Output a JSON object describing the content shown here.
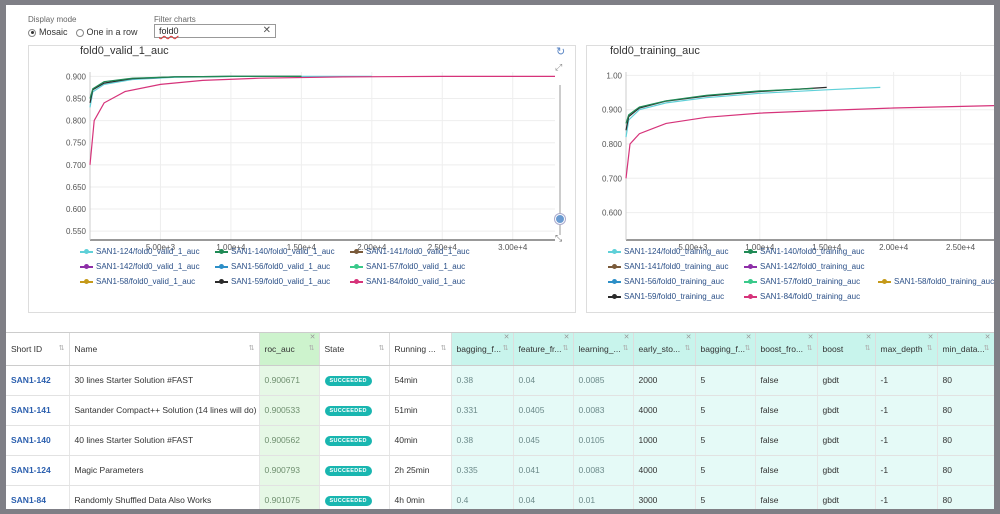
{
  "controls": {
    "display_mode_label": "Display mode",
    "mode_mosaic": "Mosaic",
    "mode_one_in_row": "One in a row",
    "filter_label": "Filter charts",
    "filter_value": "fold0",
    "clear_icon": "✕"
  },
  "charts": [
    {
      "id": "valid",
      "title": "fold0_valid_1_auc",
      "legend": [
        {
          "label": "SAN1-124/fold0_valid_1_auc",
          "color": "#5fd0d8"
        },
        {
          "label": "SAN1-140/fold0_valid_1_auc",
          "color": "#1f8a55"
        },
        {
          "label": "SAN1-141/fold0_valid_1_auc",
          "color": "#7a5a3a"
        },
        {
          "label": "SAN1-142/fold0_valid_1_auc",
          "color": "#8e2fa8"
        },
        {
          "label": "SAN1-56/fold0_valid_1_auc",
          "color": "#2d8fc7"
        },
        {
          "label": "SAN1-57/fold0_valid_1_auc",
          "color": "#3ac98a"
        },
        {
          "label": "SAN1-58/fold0_valid_1_auc",
          "color": "#c59a1a"
        },
        {
          "label": "SAN1-59/fold0_valid_1_auc",
          "color": "#2b2b2b"
        },
        {
          "label": "SAN1-84/fold0_valid_1_auc",
          "color": "#d6337a"
        }
      ]
    },
    {
      "id": "training",
      "title": "fold0_training_auc",
      "legend": [
        {
          "label": "SAN1-124/fold0_training_auc",
          "color": "#5fd0d8"
        },
        {
          "label": "SAN1-140/fold0_training_auc",
          "color": "#1f8a55"
        },
        {
          "label": "SAN1-141/fold0_training_auc",
          "color": "#7a5a3a"
        },
        {
          "label": "SAN1-142/fold0_training_auc",
          "color": "#8e2fa8"
        },
        {
          "label": "SAN1-56/fold0_training_auc",
          "color": "#2d8fc7"
        },
        {
          "label": "SAN1-57/fold0_training_auc",
          "color": "#3ac98a"
        },
        {
          "label": "SAN1-58/fold0_training_auc",
          "color": "#c59a1a"
        },
        {
          "label": "SAN1-59/fold0_training_auc",
          "color": "#2b2b2b"
        },
        {
          "label": "SAN1-84/fold0_training_auc",
          "color": "#d6337a"
        }
      ]
    }
  ],
  "chart_data": [
    {
      "type": "line",
      "title": "fold0_valid_1_auc",
      "xlabel": "",
      "ylabel": "",
      "x_ticks": [
        "5.00e+3",
        "1.00e+4",
        "1.50e+4",
        "2.00e+4",
        "2.50e+4",
        "3.00e+4"
      ],
      "x_tick_values": [
        5000,
        10000,
        15000,
        20000,
        25000,
        30000
      ],
      "y_ticks": [
        "0.900",
        "0.850",
        "0.800",
        "0.750",
        "0.700",
        "0.650",
        "0.600",
        "0.550"
      ],
      "y_tick_values": [
        0.9,
        0.85,
        0.8,
        0.75,
        0.7,
        0.65,
        0.6,
        0.55
      ],
      "xlim": [
        0,
        33000
      ],
      "ylim": [
        0.53,
        0.91
      ],
      "grid": true,
      "series": [
        {
          "name": "SAN1-124/fold0_valid_1_auc",
          "color": "#5fd0d8",
          "x": [
            0,
            200,
            1000,
            3000,
            6000,
            10000,
            15000,
            20000
          ],
          "y": [
            0.83,
            0.865,
            0.882,
            0.893,
            0.898,
            0.9,
            0.9,
            0.9
          ]
        },
        {
          "name": "SAN1-59/fold0_valid_1_auc",
          "color": "#2b2b2b",
          "x": [
            0,
            200,
            1000,
            3000,
            6000,
            10000,
            15000
          ],
          "y": [
            0.84,
            0.87,
            0.885,
            0.895,
            0.899,
            0.9,
            0.9
          ]
        },
        {
          "name": "SAN1-140/fold0_valid_1_auc",
          "color": "#1f8a55",
          "x": [
            0,
            200,
            1000,
            3000,
            6000,
            10000,
            15000
          ],
          "y": [
            0.85,
            0.872,
            0.888,
            0.896,
            0.899,
            0.9,
            0.9
          ]
        },
        {
          "name": "SAN1-84/fold0_valid_1_auc",
          "color": "#d6337a",
          "x": [
            0,
            300,
            1000,
            2500,
            5000,
            8000,
            12000,
            18000,
            25000,
            33000
          ],
          "y": [
            0.7,
            0.8,
            0.84,
            0.866,
            0.882,
            0.891,
            0.896,
            0.899,
            0.9,
            0.9
          ]
        }
      ]
    },
    {
      "type": "line",
      "title": "fold0_training_auc",
      "xlabel": "",
      "ylabel": "",
      "x_ticks": [
        "5.00e+3",
        "1.00e+4",
        "1.50e+4",
        "2.00e+4",
        "2.50e+4"
      ],
      "x_tick_values": [
        5000,
        10000,
        15000,
        20000,
        25000
      ],
      "y_ticks": [
        "1.00",
        "0.900",
        "0.800",
        "0.700",
        "0.600"
      ],
      "y_tick_values": [
        1.0,
        0.9,
        0.8,
        0.7,
        0.6
      ],
      "xlim": [
        0,
        27500
      ],
      "ylim": [
        0.52,
        1.01
      ],
      "grid": true,
      "series": [
        {
          "name": "SAN1-124/fold0_training_auc",
          "color": "#5fd0d8",
          "x": [
            0,
            200,
            1000,
            3000,
            6000,
            10000,
            15000,
            19000
          ],
          "y": [
            0.82,
            0.87,
            0.9,
            0.92,
            0.935,
            0.948,
            0.958,
            0.965
          ]
        },
        {
          "name": "SAN1-59/fold0_training_auc",
          "color": "#2b2b2b",
          "x": [
            0,
            200,
            1000,
            3000,
            6000,
            10000,
            15000
          ],
          "y": [
            0.84,
            0.88,
            0.905,
            0.925,
            0.94,
            0.953,
            0.965
          ]
        },
        {
          "name": "SAN1-140/fold0_training_auc",
          "color": "#1f8a55",
          "x": [
            0,
            200,
            1000,
            3000,
            6000,
            10000,
            14000
          ],
          "y": [
            0.86,
            0.885,
            0.908,
            0.926,
            0.942,
            0.955,
            0.962
          ]
        },
        {
          "name": "SAN1-84/fold0_training_auc",
          "color": "#d6337a",
          "x": [
            0,
            300,
            1000,
            3000,
            6000,
            10000,
            15000,
            20000,
            27500
          ],
          "y": [
            0.7,
            0.8,
            0.83,
            0.86,
            0.878,
            0.89,
            0.898,
            0.905,
            0.912
          ]
        }
      ]
    }
  ],
  "table": {
    "columns": [
      {
        "label": "Short ID",
        "w": 63,
        "cls": "",
        "sort": true,
        "x": false
      },
      {
        "label": "Name",
        "w": 190,
        "cls": "",
        "sort": true,
        "x": false
      },
      {
        "label": "roc_auc",
        "w": 60,
        "cls": "roch",
        "sort": true,
        "x": true
      },
      {
        "label": "State",
        "w": 70,
        "cls": "",
        "sort": true,
        "x": false
      },
      {
        "label": "Running ...",
        "w": 62,
        "cls": "",
        "sort": true,
        "x": false
      },
      {
        "label": "bagging_f...",
        "w": 62,
        "cls": "hlh",
        "sort": true,
        "x": true
      },
      {
        "label": "feature_fr...",
        "w": 60,
        "cls": "hlh",
        "sort": true,
        "x": true
      },
      {
        "label": "learning_...",
        "w": 60,
        "cls": "hlh",
        "sort": true,
        "x": true
      },
      {
        "label": "early_sto...",
        "w": 62,
        "cls": "hlh",
        "sort": true,
        "x": true
      },
      {
        "label": "bagging_f...",
        "w": 60,
        "cls": "hlh",
        "sort": true,
        "x": true
      },
      {
        "label": "boost_fro...",
        "w": 62,
        "cls": "hlh",
        "sort": true,
        "x": true
      },
      {
        "label": "boost",
        "w": 58,
        "cls": "hlh",
        "sort": true,
        "x": true
      },
      {
        "label": "max_depth",
        "w": 62,
        "cls": "hlh",
        "sort": true,
        "x": true
      },
      {
        "label": "min_data...",
        "w": 57,
        "cls": "hlh",
        "sort": true,
        "x": true
      }
    ],
    "rows": [
      {
        "id": "SAN1-142",
        "name": "30 lines Starter Solution #FAST",
        "roc": "0.900671",
        "state": "SUCCEEDED",
        "running": "54min",
        "vals": [
          "0.38",
          "0.04",
          "0.0085",
          "2000",
          "5",
          "false",
          "gbdt",
          "-1",
          "80"
        ]
      },
      {
        "id": "SAN1-141",
        "name": "Santander Compact++ Solution (14 lines will do)",
        "roc": "0.900533",
        "state": "SUCCEEDED",
        "running": "51min",
        "vals": [
          "0.331",
          "0.0405",
          "0.0083",
          "4000",
          "5",
          "false",
          "gbdt",
          "-1",
          "80"
        ]
      },
      {
        "id": "SAN1-140",
        "name": "40 lines Starter Solution #FAST",
        "roc": "0.900562",
        "state": "SUCCEEDED",
        "running": "40min",
        "vals": [
          "0.38",
          "0.045",
          "0.0105",
          "1000",
          "5",
          "false",
          "gbdt",
          "-1",
          "80"
        ]
      },
      {
        "id": "SAN1-124",
        "name": "Magic Parameters",
        "roc": "0.900793",
        "state": "SUCCEEDED",
        "running": "2h 25min",
        "vals": [
          "0.335",
          "0.041",
          "0.0083",
          "4000",
          "5",
          "false",
          "gbdt",
          "-1",
          "80"
        ]
      },
      {
        "id": "SAN1-84",
        "name": "Randomly Shuffled Data Also Works",
        "roc": "0.901075",
        "state": "SUCCEEDED",
        "running": "4h 0min",
        "vals": [
          "0.4",
          "0.04",
          "0.01",
          "3000",
          "5",
          "false",
          "gbdt",
          "-1",
          "80"
        ]
      }
    ]
  }
}
